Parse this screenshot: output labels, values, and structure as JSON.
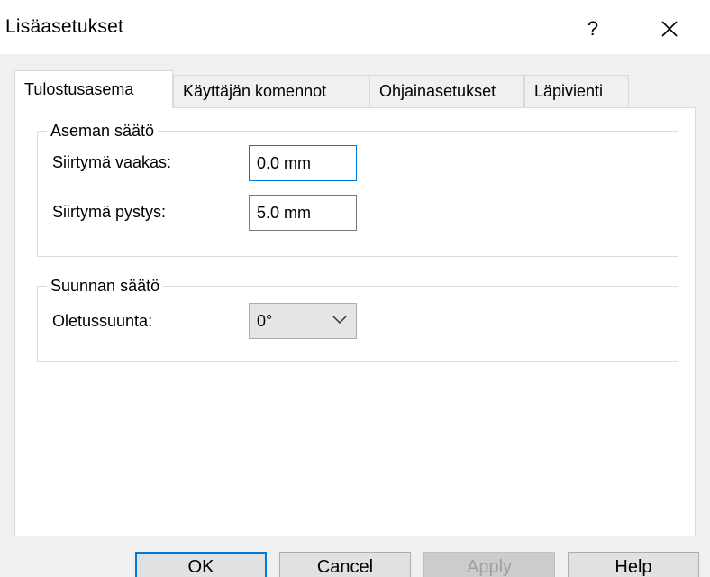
{
  "window": {
    "title": "Lisäasetukset",
    "help_symbol": "?",
    "close_icon": "close-icon"
  },
  "tabs": [
    {
      "label": "Tulostusasema",
      "active": true
    },
    {
      "label": "Käyttäjän komennot",
      "active": false
    },
    {
      "label": "Ohjainasetukset",
      "active": false
    },
    {
      "label": "Läpivienti",
      "active": false
    }
  ],
  "position_group": {
    "legend": "Aseman säätö",
    "horizontal_label": "Siirtymä vaakas:",
    "horizontal_value": "0.0 mm",
    "vertical_label": "Siirtymä pystys:",
    "vertical_value": "5.0 mm"
  },
  "orientation_group": {
    "legend": "Suunnan säätö",
    "default_label": "Oletussuunta:",
    "default_value": "0°"
  },
  "buttons": {
    "ok": "OK",
    "cancel": "Cancel",
    "apply": "Apply",
    "help": "Help"
  },
  "colors": {
    "accent": "#0078d7",
    "dialog_bg": "#f0f0f0",
    "page_bg": "#ffffff"
  }
}
